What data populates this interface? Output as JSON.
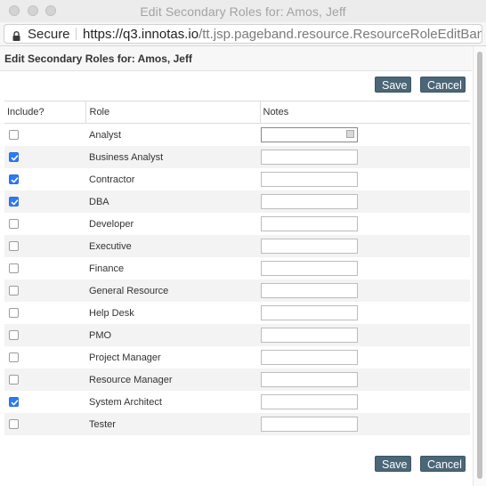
{
  "window": {
    "title": "Edit Secondary Roles for: Amos, Jeff"
  },
  "address_bar": {
    "secure_label": "Secure",
    "url_host": "https://q3.innotas.io",
    "url_path": "/tt.jsp.pageband.resource.ResourceRoleEditBan..."
  },
  "dialog": {
    "title": "Edit Secondary Roles for: Amos, Jeff",
    "save_label": "Save",
    "cancel_label": "Cancel"
  },
  "table": {
    "headers": [
      "Include?",
      "Role",
      "Notes"
    ],
    "rows": [
      {
        "role": "Analyst",
        "included": false,
        "notes": ""
      },
      {
        "role": "Business Analyst",
        "included": true,
        "notes": ""
      },
      {
        "role": "Contractor",
        "included": true,
        "notes": ""
      },
      {
        "role": "DBA",
        "included": true,
        "notes": ""
      },
      {
        "role": "Developer",
        "included": false,
        "notes": ""
      },
      {
        "role": "Executive",
        "included": false,
        "notes": ""
      },
      {
        "role": "Finance",
        "included": false,
        "notes": ""
      },
      {
        "role": "General Resource",
        "included": false,
        "notes": ""
      },
      {
        "role": "Help Desk",
        "included": false,
        "notes": ""
      },
      {
        "role": "PMO",
        "included": false,
        "notes": ""
      },
      {
        "role": "Project Manager",
        "included": false,
        "notes": ""
      },
      {
        "role": "Resource Manager",
        "included": false,
        "notes": ""
      },
      {
        "role": "System Architect",
        "included": true,
        "notes": ""
      },
      {
        "role": "Tester",
        "included": false,
        "notes": ""
      }
    ]
  },
  "colors": {
    "button_bg": "#4a6677",
    "checkbox_checked": "#2d7bf4",
    "row_stripe": "#f3f3f3"
  },
  "icons": {
    "lock": "lock-icon",
    "checkmark": "checkmark-icon",
    "keyboard": "keyboard-icon"
  }
}
